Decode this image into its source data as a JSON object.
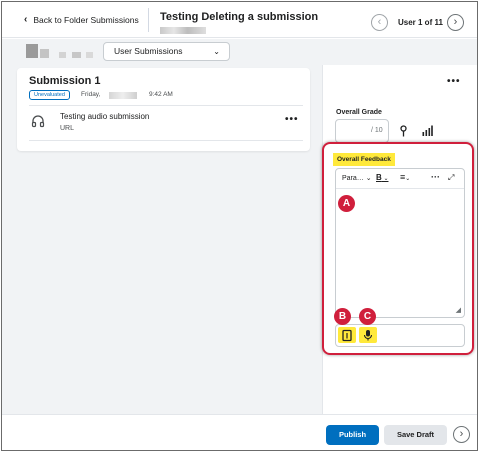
{
  "header": {
    "back_label": "Back to Folder Submissions",
    "title": "Testing Deleting a submission",
    "user_count": "User 1 of 11"
  },
  "subbar": {
    "view_select": "User Submissions"
  },
  "submission": {
    "title": "Submission 1",
    "status_badge": "Unevaluated",
    "day": "Friday,",
    "time": "9:42 AM",
    "file_name": "Testing audio submission",
    "file_type": "URL"
  },
  "grading": {
    "overall_grade_label": "Overall Grade",
    "grade_value": "",
    "grade_denominator": "/ 10",
    "overall_feedback_label": "Overall Feedback"
  },
  "editor": {
    "paragraph_label": "Para…",
    "bold_label": "B"
  },
  "markers": {
    "a": "A",
    "b": "B",
    "c": "C"
  },
  "footer": {
    "publish_label": "Publish",
    "save_draft_label": "Save Draft"
  },
  "colors": {
    "primary": "#006fbf",
    "highlight": "#ffe93b",
    "marker_red": "#d01f3c"
  },
  "icons": {
    "back": "chevron-left-icon",
    "prev": "chevron-left-circle-icon",
    "next": "chevron-right-circle-icon",
    "audio": "headphones-icon",
    "more": "more-horizontal-icon",
    "pin": "pin-icon",
    "stats": "bar-chart-icon",
    "attach": "document-icon",
    "mic": "microphone-icon"
  }
}
